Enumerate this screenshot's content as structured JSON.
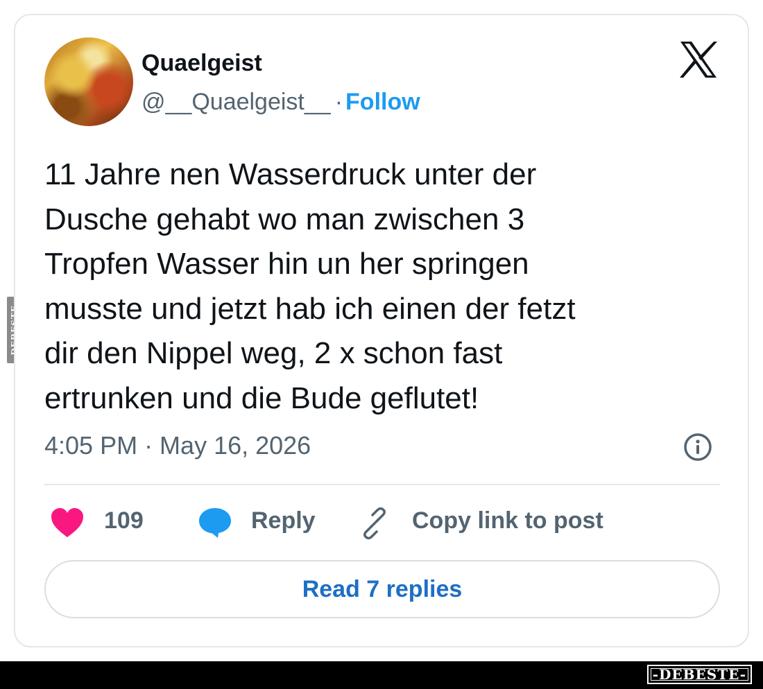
{
  "watermark": {
    "side_text": "DEBESTE",
    "bottom_text": "-DEBESTE-"
  },
  "author": {
    "display_name": "Quaelgeist",
    "handle": "@__Quaelgeist__",
    "separator": "·",
    "follow_label": "Follow"
  },
  "icons": {
    "platform_logo": "x-logo-icon",
    "info": "info-icon",
    "like": "heart-icon",
    "reply": "speech-bubble-icon",
    "copy_link": "link-icon"
  },
  "tweet": {
    "text_lines": [
      "11 Jahre nen Wasserdruck unter der",
      "Dusche gehabt wo man zwischen 3",
      "Tropfen Wasser hin un her springen",
      "musste und jetzt hab ich einen der fetzt",
      "dir den Nippel weg, 2 x schon fast",
      "ertrunken und die Bude geflutet!"
    ],
    "timestamp": "4:05 PM · May 16, 2026"
  },
  "actions": {
    "like_count": "109",
    "reply_label": "Reply",
    "copy_link_label": "Copy link to post"
  },
  "read_replies_label": "Read 7 replies",
  "colors": {
    "accent_blue": "#1d9bf0",
    "like_pink": "#f91880",
    "muted_gray": "#536471",
    "text_dark": "#0f1419"
  }
}
